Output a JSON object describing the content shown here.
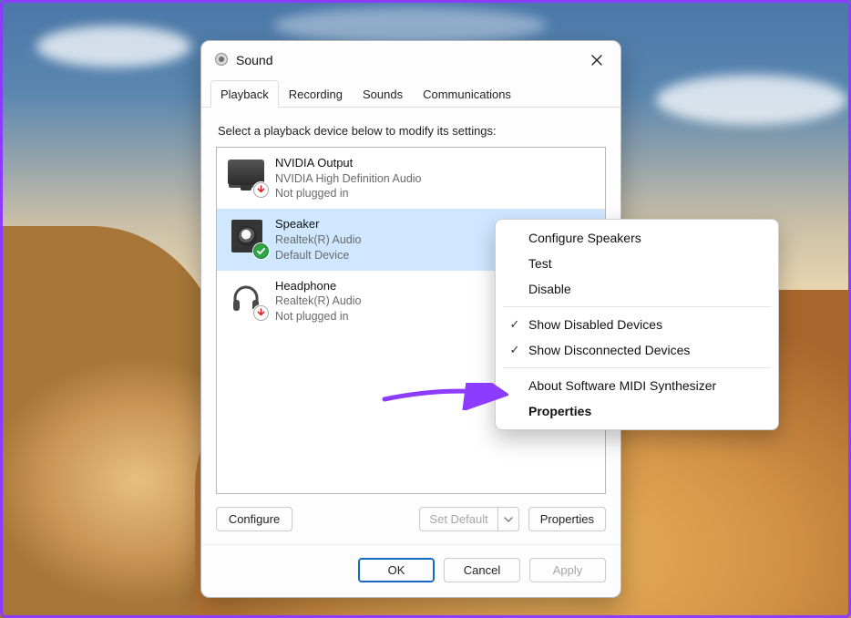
{
  "window": {
    "title": "Sound"
  },
  "tabs": {
    "t0": "Playback",
    "t1": "Recording",
    "t2": "Sounds",
    "t3": "Communications",
    "active_index": 0
  },
  "hint": "Select a playback device below to modify its settings:",
  "devices": [
    {
      "title": "NVIDIA Output",
      "sub1": "NVIDIA High Definition Audio",
      "sub2": "Not plugged in",
      "icon": "monitor",
      "badge": "down",
      "selected": false
    },
    {
      "title": "Speaker",
      "sub1": "Realtek(R) Audio",
      "sub2": "Default Device",
      "icon": "speaker",
      "badge": "ok",
      "selected": true
    },
    {
      "title": "Headphone",
      "sub1": "Realtek(R) Audio",
      "sub2": "Not plugged in",
      "icon": "headphone",
      "badge": "down",
      "selected": false
    }
  ],
  "buttons": {
    "configure": "Configure",
    "set_default": "Set Default",
    "properties": "Properties",
    "ok": "OK",
    "cancel": "Cancel",
    "apply": "Apply"
  },
  "context_menu": {
    "items": [
      {
        "label": "Configure Speakers",
        "checked": false,
        "bold": false
      },
      {
        "label": "Test",
        "checked": false,
        "bold": false
      },
      {
        "label": "Disable",
        "checked": false,
        "bold": false
      },
      {
        "sep": true
      },
      {
        "label": "Show Disabled Devices",
        "checked": true,
        "bold": false
      },
      {
        "label": "Show Disconnected Devices",
        "checked": true,
        "bold": false
      },
      {
        "sep": true
      },
      {
        "label": "About Software MIDI Synthesizer",
        "checked": false,
        "bold": false
      },
      {
        "label": "Properties",
        "checked": false,
        "bold": true
      }
    ]
  },
  "annotation": {
    "color": "#8d3bff"
  }
}
